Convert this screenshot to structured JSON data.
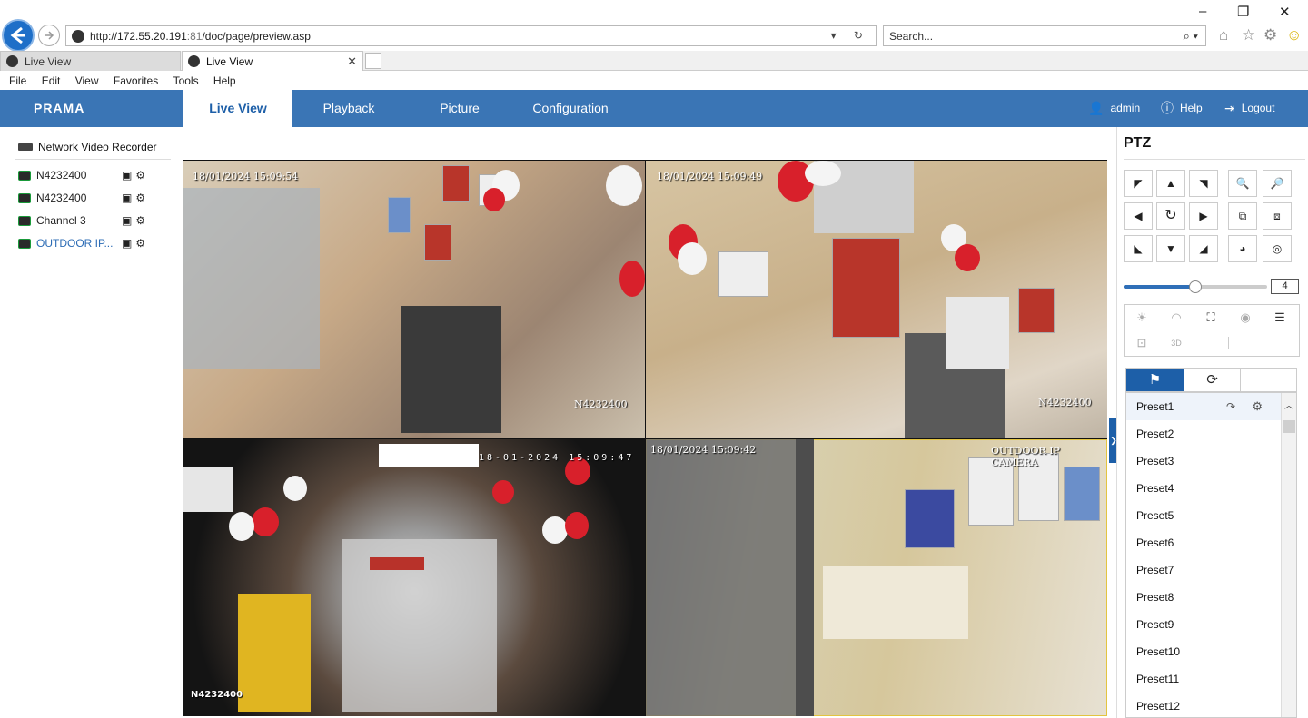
{
  "browser": {
    "url_prefix": "http://172.55.20.191",
    "url_port": ":81",
    "url_path": "/doc/page/preview.asp",
    "search_placeholder": "Search...",
    "tabs": [
      {
        "title": "Live View"
      },
      {
        "title": "Live View"
      }
    ],
    "menu": [
      "File",
      "Edit",
      "View",
      "Favorites",
      "Tools",
      "Help"
    ]
  },
  "app": {
    "logo": "PRAMA",
    "nav": [
      {
        "label": "Live View",
        "active": true
      },
      {
        "label": "Playback"
      },
      {
        "label": "Picture"
      },
      {
        "label": "Configuration"
      }
    ],
    "user": "admin",
    "help": "Help",
    "logout": "Logout"
  },
  "device_tree": {
    "title": "Network Video Recorder",
    "channels": [
      {
        "name": "N4232400"
      },
      {
        "name": "N4232400"
      },
      {
        "name": "Channel 3"
      },
      {
        "name": "OUTDOOR IP..."
      }
    ]
  },
  "videos": [
    {
      "timestamp": "18/01/2024 15:09:54",
      "label": "N4232400"
    },
    {
      "timestamp": "18/01/2024 15:09:49",
      "label": "N4232400"
    },
    {
      "timestamp": "18-01-2024 15:09:47",
      "label": "N4232400"
    },
    {
      "timestamp": "18/01/2024 15:09:42",
      "label": "OUTDOOR IP CAMERA"
    }
  ],
  "ptz": {
    "title": "PTZ",
    "speed": "4",
    "speed_fraction": 0.5,
    "presets": [
      "Preset1",
      "Preset2",
      "Preset3",
      "Preset4",
      "Preset5",
      "Preset6",
      "Preset7",
      "Preset8",
      "Preset9",
      "Preset10",
      "Preset11",
      "Preset12"
    ]
  }
}
